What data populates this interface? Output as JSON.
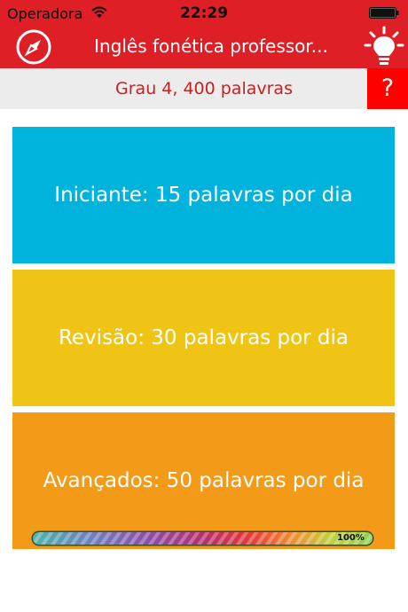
{
  "statusbar": {
    "carrier": "Operadora",
    "time": "22:29"
  },
  "navbar": {
    "title": "Inglês fonética professor...",
    "icons": [
      "compass-icon",
      "lightbulb-icon"
    ]
  },
  "grade": {
    "label": "Grau 4, 400 palavras",
    "help_label": "?"
  },
  "levels": [
    {
      "label": "Iniciante: 15 palavras por dia",
      "color": "#00b3dc"
    },
    {
      "label": "Revisão: 30 palavras por dia",
      "color": "#f0c414"
    },
    {
      "label": "Avançados: 50 palavras por dia",
      "color": "#f39b18"
    }
  ],
  "progress": {
    "percent": 100,
    "label": "100%"
  },
  "colors": {
    "brand": "#de1f26",
    "help": "#fd0000",
    "grade_text": "#c92020"
  }
}
